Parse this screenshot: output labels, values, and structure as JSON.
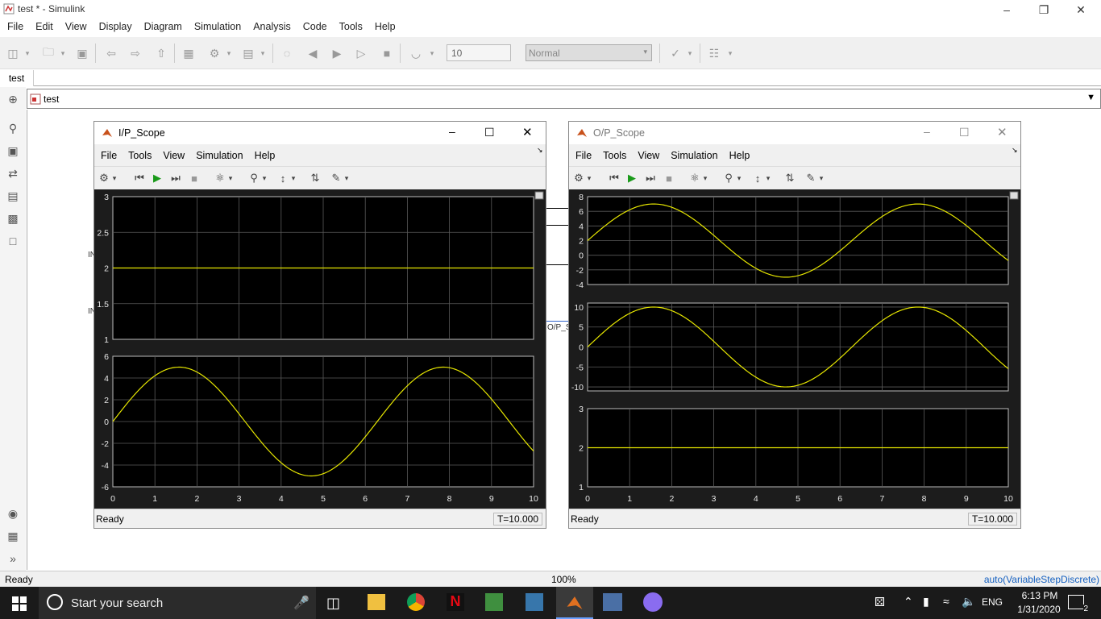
{
  "window": {
    "title": "test * - Simulink"
  },
  "menubar": [
    "File",
    "Edit",
    "View",
    "Display",
    "Diagram",
    "Simulation",
    "Analysis",
    "Code",
    "Tools",
    "Help"
  ],
  "toolbar": {
    "stop_time": "10",
    "sim_mode": "Normal"
  },
  "tabs": [
    {
      "label": "test"
    }
  ],
  "address": {
    "path": "test"
  },
  "canvas_labels": {
    "in1": "IN",
    "in2": "IN",
    "op": "O/P_S"
  },
  "status": {
    "left": "Ready",
    "zoom": "100%",
    "solver": "auto(VariableStepDiscrete)"
  },
  "scope_menu": [
    "File",
    "Tools",
    "View",
    "Simulation",
    "Help"
  ],
  "ip_scope": {
    "title": "I/P_Scope",
    "status": "Ready",
    "time": "T=10.000"
  },
  "op_scope": {
    "title": "O/P_Scope",
    "status": "Ready",
    "time": "T=10.000"
  },
  "taskbar": {
    "search": "Start your search",
    "lang": "ENG",
    "time": "6:13 PM",
    "date": "1/31/2020",
    "notif_count": "2"
  },
  "colors": {
    "trace": "#e6e600",
    "plot_bg": "#000000",
    "axes_bg": "#1c1c1c",
    "taskbar": "#1a1a1a"
  },
  "chart_data": [
    {
      "type": "line",
      "scope": "I/P_Scope",
      "panel": 1,
      "x": [
        0,
        10
      ],
      "series": [
        {
          "values": [
            2,
            2
          ]
        }
      ],
      "xlim": [
        0,
        10
      ],
      "ylim": [
        1,
        3
      ],
      "yticks": [
        "1",
        "1.5",
        "2",
        "2.5",
        "3"
      ],
      "xticks": [],
      "grid": true
    },
    {
      "type": "line",
      "scope": "I/P_Scope",
      "panel": 2,
      "function": "5*sin(t)",
      "xlim": [
        0,
        10
      ],
      "ylim": [
        -6,
        6
      ],
      "yticks": [
        "-6",
        "-4",
        "-2",
        "0",
        "2",
        "4",
        "6"
      ],
      "xticks": [
        "0",
        "1",
        "2",
        "3",
        "4",
        "5",
        "6",
        "7",
        "8",
        "9",
        "10"
      ],
      "grid": true
    },
    {
      "type": "line",
      "scope": "O/P_Scope",
      "panel": 1,
      "function": "2+5*sin(t)",
      "xlim": [
        0,
        10
      ],
      "ylim": [
        -4,
        8
      ],
      "yticks": [
        "-4",
        "-2",
        "0",
        "2",
        "4",
        "6",
        "8"
      ],
      "xticks": [],
      "grid": true
    },
    {
      "type": "line",
      "scope": "O/P_Scope",
      "panel": 2,
      "function": "10*sin(t)",
      "xlim": [
        0,
        10
      ],
      "ylim": [
        -11,
        11
      ],
      "yticks": [
        "-10",
        "-5",
        "0",
        "5",
        "10"
      ],
      "xticks": [],
      "grid": true
    },
    {
      "type": "line",
      "scope": "O/P_Scope",
      "panel": 3,
      "x": [
        0,
        10
      ],
      "series": [
        {
          "values": [
            2,
            2
          ]
        }
      ],
      "xlim": [
        0,
        10
      ],
      "ylim": [
        1,
        3
      ],
      "yticks": [
        "1",
        "2",
        "3"
      ],
      "xticks": [
        "0",
        "1",
        "2",
        "3",
        "4",
        "5",
        "6",
        "7",
        "8",
        "9",
        "10"
      ],
      "grid": true
    }
  ]
}
